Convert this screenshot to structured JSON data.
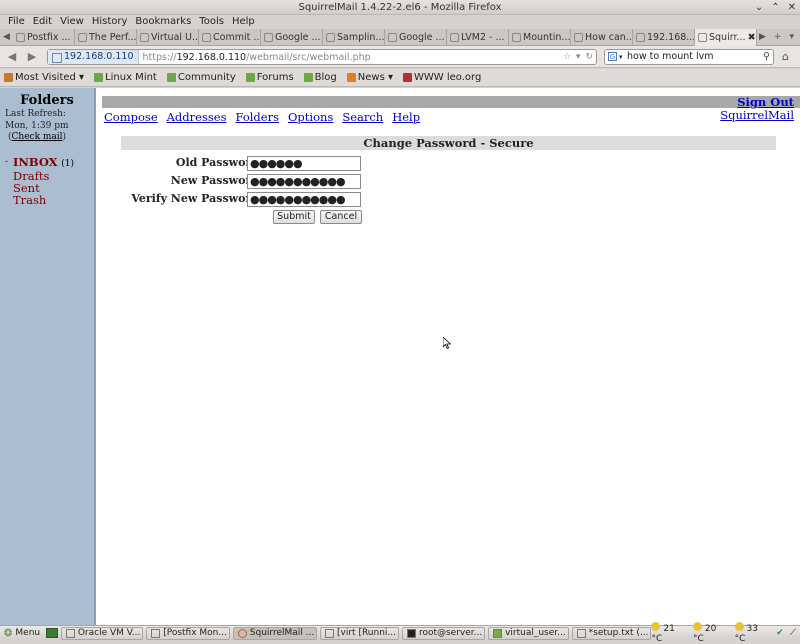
{
  "window": {
    "title": "SquirrelMail 1.4.22-2.el6 - Mozilla Firefox"
  },
  "menubar": [
    "File",
    "Edit",
    "View",
    "History",
    "Bookmarks",
    "Tools",
    "Help"
  ],
  "tabs": [
    {
      "label": "Postfix ...",
      "active": false
    },
    {
      "label": "The Perf...",
      "active": false
    },
    {
      "label": "Virtual U...",
      "active": false
    },
    {
      "label": "Commit ...",
      "active": false
    },
    {
      "label": "Google ...",
      "active": false
    },
    {
      "label": "Samplin...",
      "active": false
    },
    {
      "label": "Google ...",
      "active": false
    },
    {
      "label": "LVM2 - ...",
      "active": false
    },
    {
      "label": "Mountin...",
      "active": false
    },
    {
      "label": "How can...",
      "active": false
    },
    {
      "label": "192.168....",
      "active": false
    },
    {
      "label": "Squirr...",
      "active": true
    }
  ],
  "nav": {
    "identity": "192.168.0.110",
    "url_prefix": "https://",
    "url_host": "192.168.0.110",
    "url_path": "/webmail/src/webmail.php",
    "search_value": "how to mount lvm"
  },
  "bookmarks": [
    {
      "label": "Most Visited ▾",
      "color": "#c87a2a"
    },
    {
      "label": "Linux Mint",
      "color": "#6ea742"
    },
    {
      "label": "Community",
      "color": "#6ea742"
    },
    {
      "label": "Forums",
      "color": "#6ea742"
    },
    {
      "label": "Blog",
      "color": "#6ea742"
    },
    {
      "label": "News ▾",
      "color": "#e87b1e"
    },
    {
      "label": "WWW leo.org",
      "color": "#b8302c"
    }
  ],
  "sidebar": {
    "title": "Folders",
    "refresh_label": "Last Refresh:",
    "refresh_time": "Mon, 1:39 pm",
    "check_mail": "Check mail",
    "inbox": {
      "label": "INBOX",
      "count": "(1)"
    },
    "folders": [
      "Drafts",
      "Sent",
      "Trash"
    ]
  },
  "main": {
    "sign_out": "Sign Out",
    "nav_links": [
      "Compose",
      "Addresses",
      "Folders",
      "Options",
      "Search",
      "Help"
    ],
    "brand_link": "SquirrelMail",
    "panel_title": "Change Password - Secure",
    "fields": [
      {
        "label": "Old Password:",
        "value": "●●●●●●"
      },
      {
        "label": "New Password:",
        "value": "●●●●●●●●●●●"
      },
      {
        "label": "Verify New Password:",
        "value": "●●●●●●●●●●●"
      }
    ],
    "submit_label": "Submit",
    "cancel_label": "Cancel"
  },
  "taskbar": {
    "menu_label": "Menu",
    "items": [
      {
        "label": "Oracle VM V...",
        "active": false
      },
      {
        "label": "[Postfix Mon...",
        "active": false
      },
      {
        "label": "SquirrelMail ...",
        "active": true
      },
      {
        "label": "[virt [Runni...",
        "active": false
      },
      {
        "label": "root@server...",
        "active": false
      },
      {
        "label": "virtual_user...",
        "active": false
      },
      {
        "label": "*setup.txt (...",
        "active": false
      }
    ],
    "temps": [
      "21 °C",
      "20 °C",
      "33 °C"
    ]
  }
}
